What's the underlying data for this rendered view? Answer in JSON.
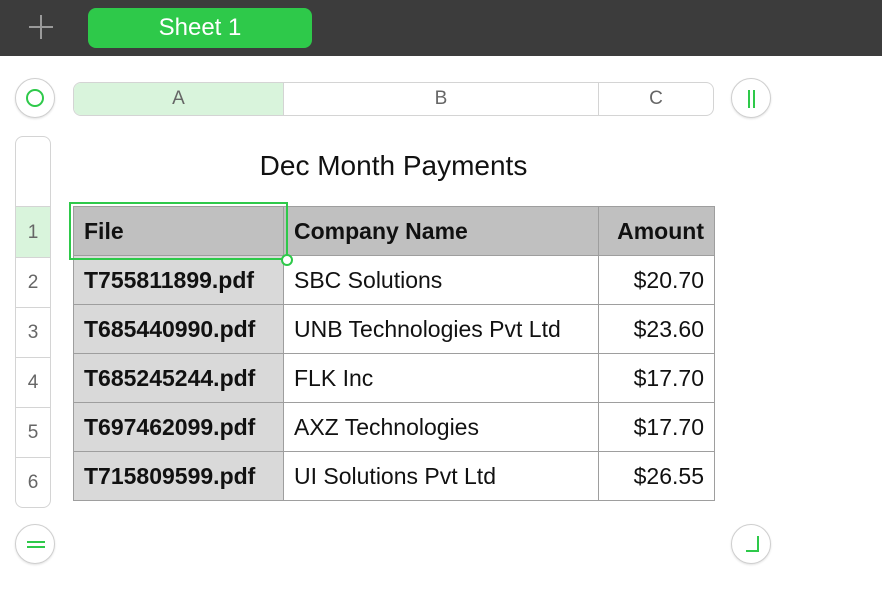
{
  "toolbar": {
    "add_sheet_icon": "plus-icon",
    "sheet_tab_label": "Sheet 1",
    "accent_color": "#2ec94a"
  },
  "column_headers": [
    "A",
    "B",
    "C"
  ],
  "selected_column": "A",
  "row_headers": [
    "1",
    "2",
    "3",
    "4",
    "5",
    "6"
  ],
  "selected_row": "1",
  "table": {
    "title": "Dec Month Payments",
    "header": [
      "File",
      "Company Name",
      "Amount"
    ],
    "rows": [
      [
        "T755811899.pdf",
        "SBC Solutions",
        "$20.70"
      ],
      [
        "T685440990.pdf",
        "UNB Technologies Pvt Ltd",
        "$23.60"
      ],
      [
        "T685245244.pdf",
        "FLK Inc",
        "$17.70"
      ],
      [
        "T697462099.pdf",
        "AXZ Technologies",
        "$17.70"
      ],
      [
        "T715809599.pdf",
        "UI Solutions Pvt Ltd",
        "$26.55"
      ]
    ]
  },
  "handles": {
    "select_all_icon": "circle-icon",
    "column_handle_icon": "column-handle-icon",
    "row_handle_icon": "row-handle-icon",
    "resize_icon": "resize-corner-icon"
  }
}
